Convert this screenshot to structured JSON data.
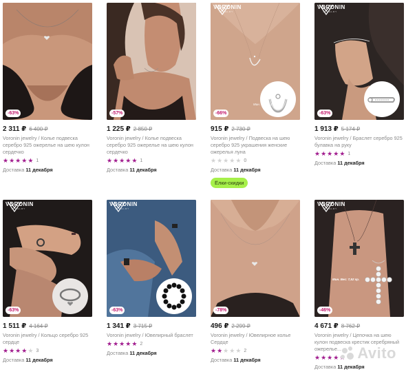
{
  "products": [
    {
      "price": "2 311 ₽",
      "old_price": "6 400 ₽",
      "discount": "-63%",
      "title": "Voronin jewelry / Колье подвеска серебро 925 ожерелье на шею кулон сердечко",
      "rating_stars": 5,
      "rating_count": "1",
      "delivery_label": "Доставка",
      "delivery_date": "11 декабря",
      "logo": false
    },
    {
      "price": "1 225 ₽",
      "old_price": "2 850 ₽",
      "discount": "-57%",
      "title": "Voronin jewelry / Колье подвеска серебро 925 ожерелье на шею кулон сердечко",
      "rating_stars": 5,
      "rating_count": "1",
      "delivery_label": "Доставка",
      "delivery_date": "11 декабря",
      "logo": false
    },
    {
      "price": "915 ₽",
      "old_price": "2 730 ₽",
      "discount": "-66%",
      "title": "Voronin jewelry / Подвеска на шею серебро 925 украшения женские ожерелья луна",
      "rating_stars": 0,
      "rating_count": "0",
      "delivery_label": "Доставка",
      "delivery_date": "11 декабря",
      "logo": true,
      "weight_note": "Мин. Вес: 1,20 гр.",
      "promo": "Ёлки-скидки"
    },
    {
      "price": "1 913 ₽",
      "old_price": "5 174 ₽",
      "discount": "-63%",
      "title": "Voronin jewelry / Браслет серебро 925 булавка на руку",
      "rating_stars": 5,
      "rating_count": "1",
      "delivery_label": "Доставка",
      "delivery_date": "11 декабря",
      "logo": true
    },
    {
      "price": "1 511 ₽",
      "old_price": "4 164 ₽",
      "discount": "-63%",
      "title": "Voronin jewelry / Кольцо серебро 925 сердце",
      "rating_stars": 4,
      "rating_count": "3",
      "delivery_label": "Доставка",
      "delivery_date": "11 декабря",
      "logo": true
    },
    {
      "price": "1 341 ₽",
      "old_price": "3 715 ₽",
      "discount": "-63%",
      "title": "Voronin jewelry / Ювелирный браслет",
      "rating_stars": 5,
      "rating_count": "2",
      "delivery_label": "Доставка",
      "delivery_date": "11 декабря",
      "logo": true
    },
    {
      "price": "496 ₽",
      "old_price": "2 299 ₽",
      "discount": "-78%",
      "title": "Voronin jewelry / Ювелирное колье Сердце",
      "rating_stars": 2,
      "rating_count": "2",
      "delivery_label": "Доставка",
      "delivery_date": "11 декабря",
      "logo": false
    },
    {
      "price": "4 671 ₽",
      "old_price": "8 762 ₽",
      "discount": "-46%",
      "title": "Voronin jewelry / Цепочка на шею кулон подвеска крестик серебряный ожерелье...",
      "rating_stars": 5,
      "rating_count": "",
      "delivery_label": "Доставка",
      "delivery_date": "11 декабря",
      "logo": true,
      "weight_note": "Мин. Вес: 7,52 гр."
    }
  ],
  "brand_logo": {
    "word": "VORONIN",
    "sub": "JEWELRY"
  },
  "watermark": "Avito",
  "colors": {
    "star": "#a21e8f",
    "discount": "#c2186b",
    "promo_bg": "#a6f04a"
  }
}
